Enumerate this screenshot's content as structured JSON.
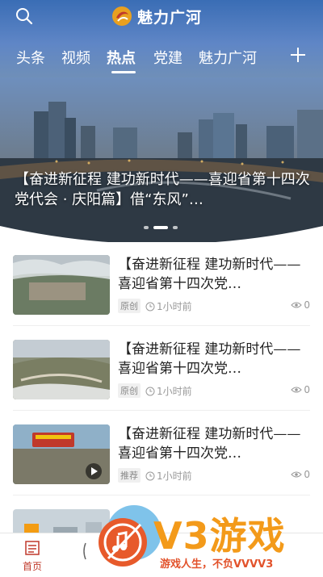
{
  "app": {
    "logo_text": "魅力广河"
  },
  "tabs": [
    {
      "label": "头条"
    },
    {
      "label": "视频"
    },
    {
      "label": "热点"
    },
    {
      "label": "党建"
    },
    {
      "label": "魅力广河"
    }
  ],
  "banner": {
    "title": "【奋进新征程 建功新时代——喜迎省第十四次党代会 · 庆阳篇】借“东风”…"
  },
  "news": [
    {
      "title": "【奋进新征程 建功新时代——喜迎省第十四次党…",
      "tag": "原创",
      "time": "1小时前",
      "views": "0"
    },
    {
      "title": "【奋进新征程 建功新时代——喜迎省第十四次党…",
      "tag": "原创",
      "time": "1小时前",
      "views": "0"
    },
    {
      "title": "【奋进新征程 建功新时代——喜迎省第十四次党…",
      "tag": "推荐",
      "time": "1小时前",
      "views": "0"
    }
  ],
  "bottom_nav": {
    "home_label": "首页"
  },
  "watermark": {
    "text": "V3游戏",
    "sub": "游戏人生，不负VVVV3"
  }
}
